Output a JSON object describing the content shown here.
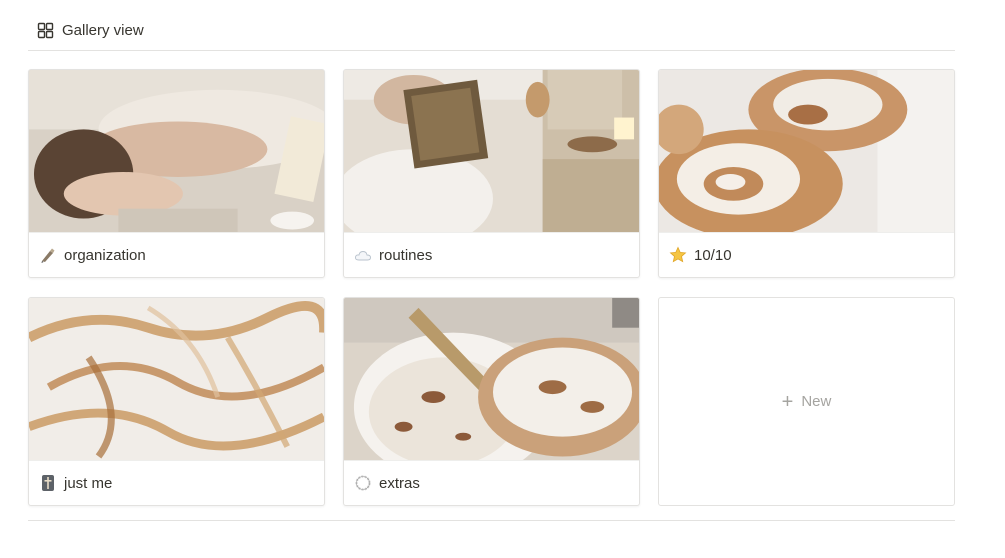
{
  "view": {
    "label": "Gallery view",
    "icon": "gallery-grid-icon"
  },
  "cards": [
    {
      "title": "organization",
      "icon": "pen-icon"
    },
    {
      "title": "routines",
      "icon": "cloud-icon"
    },
    {
      "title": "10/10",
      "icon": "star-icon"
    },
    {
      "title": "just me",
      "icon": "cross-icon"
    },
    {
      "title": "extras",
      "icon": "wreath-icon"
    }
  ],
  "new_card": {
    "label": "New",
    "icon": "plus-icon"
  },
  "colors": {
    "text": "#37352f",
    "muted": "#a5a4a0",
    "border": "#e3e2e0",
    "star": "#f5c542"
  }
}
